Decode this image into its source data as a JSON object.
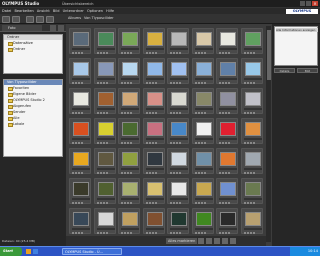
{
  "window": {
    "title": "OLYMPUS Studio",
    "subtitle": "Übersichtsbereich"
  },
  "menu": [
    "Datei",
    "Bearbeiten",
    "Ansicht",
    "Bild",
    "Unterordner",
    "Optionen",
    "Hilfe"
  ],
  "logo": "OLYMPUS",
  "breadcrumb": [
    "Albums",
    "Von Tlyposcilider"
  ],
  "left": {
    "view_tab": "Foto",
    "folders_header": "Ordner",
    "folders": [
      "Datensätze",
      "Ordner"
    ],
    "tree_header": "Von Tlyposcilider",
    "tree": [
      "Favoriten",
      "Eigene Bilder",
      "OLYMPUS Studio 2",
      "Abgerufen",
      "Sender",
      "Alle",
      "Lokale"
    ],
    "status": "Dateien: 40   (25.4 MB)"
  },
  "right": {
    "item": "Alle Informationen anzeigen",
    "btn1": "Details",
    "btn2": "Bild"
  },
  "bottom": {
    "select_all": "Alles markieren"
  },
  "taskbar": {
    "start": "Start",
    "task": "OLYMPUS Studio - Ü...",
    "clock": "10:14"
  },
  "thumbs": [
    "#5a6a7a",
    "#4a8a5a",
    "#7aa858",
    "#d8b040",
    "#b8b8b8",
    "#d8c8a8",
    "#e8e8e0",
    "#60a060",
    "#a8c8e8",
    "#8898b8",
    "#b8d8f0",
    "#90b8e8",
    "#a0c0f0",
    "#8ab0d8",
    "#6080a8",
    "#98c8e8",
    "#e8e8e0",
    "#a06030",
    "#d0a878",
    "#d89088",
    "#d8d8d0",
    "#888868",
    "#9090a0",
    "#c0c0c8",
    "#d85020",
    "#d8d030",
    "#4a6a30",
    "#c87080",
    "#4888c8",
    "#f0f0f0",
    "#e02030",
    "#e09040",
    "#e8a820",
    "#605840",
    "#90a040",
    "#303840",
    "#d0d8e0",
    "#7090a8",
    "#e07830",
    "#a0a8b0",
    "#3a3a2a",
    "#506030",
    "#a8b070",
    "#d8c070",
    "#e8e8e8",
    "#c8a850",
    "#7090d0",
    "#6a7a50",
    "#384858",
    "#d8d8d8",
    "#c0a060",
    "#805030",
    "#203830",
    "#408820",
    "#2a2a2a",
    "#b8a070"
  ]
}
